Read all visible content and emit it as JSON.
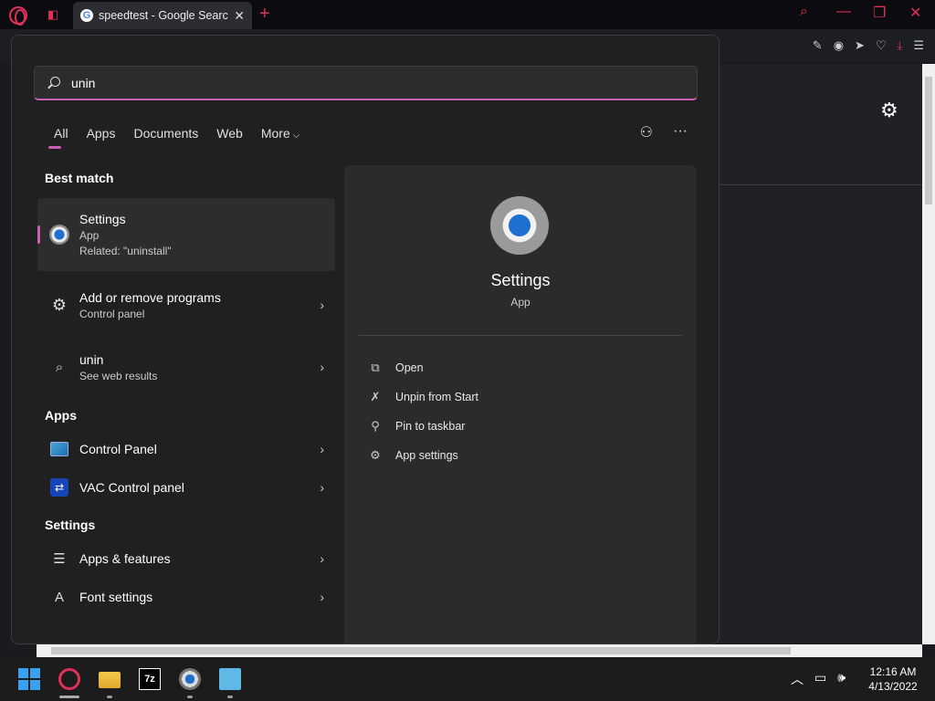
{
  "browser": {
    "tab_title": "speedtest - Google Search",
    "tab_icon_letter": "G",
    "new_tab_symbol": "+"
  },
  "search": {
    "query": "unin",
    "placeholder": ""
  },
  "filters": {
    "tabs": [
      "All",
      "Apps",
      "Documents",
      "Web",
      "More"
    ],
    "active": "All"
  },
  "best_match": {
    "section": "Best match",
    "title": "Settings",
    "type": "App",
    "related": "Related: \"uninstall\""
  },
  "results": [
    {
      "title": "Add or remove programs",
      "sub": "Control panel"
    },
    {
      "title": "unin",
      "sub": "See web results"
    }
  ],
  "apps": {
    "section": "Apps",
    "items": [
      "Control Panel",
      "VAC Control panel"
    ]
  },
  "settings": {
    "section": "Settings",
    "items": [
      "Apps & features",
      "Font settings"
    ]
  },
  "detail": {
    "title": "Settings",
    "type": "App",
    "actions": [
      "Open",
      "Unpin from Start",
      "Pin to taskbar",
      "App settings"
    ]
  },
  "taskbar": {
    "z7_label": "7z",
    "time": "12:16 AM",
    "date": "4/13/2022"
  },
  "colors": {
    "accent": "#c85fb0",
    "opera_red": "#e0305a",
    "panel_bg": "#202020"
  }
}
